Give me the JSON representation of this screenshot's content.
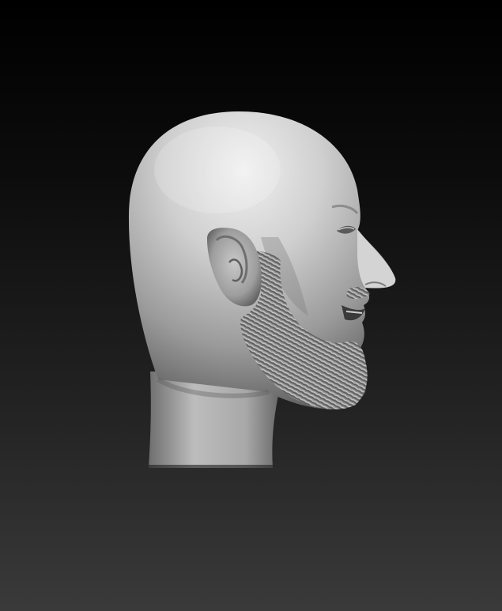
{
  "scene": {
    "subject": "sculpted-head-profile",
    "colors": {
      "background_top": "#000000",
      "background_bottom": "#3a3a3a",
      "clay_light": "#e6e6e6",
      "clay_mid": "#a9a9a9",
      "clay_dark": "#4a4a4a"
    }
  }
}
